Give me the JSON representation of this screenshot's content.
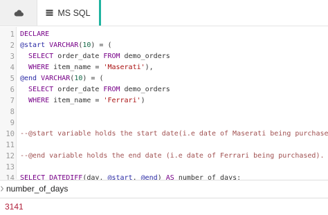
{
  "tabs": {
    "cloud_icon": "cloud-icon",
    "db_icon": "database-icon",
    "active_label": "MS SQL",
    "accent_color": "#1fb3a0"
  },
  "editor": {
    "lines": [
      {
        "num": "1",
        "segments": [
          {
            "t": "DECLARE",
            "c": "kw"
          }
        ]
      },
      {
        "num": "2",
        "segments": [
          {
            "t": "@start",
            "c": "var"
          },
          {
            "t": " "
          },
          {
            "t": "VARCHAR",
            "c": "kw"
          },
          {
            "t": "("
          },
          {
            "t": "10",
            "c": "num"
          },
          {
            "t": ") = ("
          }
        ]
      },
      {
        "num": "3",
        "segments": [
          {
            "t": "  "
          },
          {
            "t": "SELECT",
            "c": "kw"
          },
          {
            "t": " order_date "
          },
          {
            "t": "FROM",
            "c": "kw"
          },
          {
            "t": " demo_orders"
          }
        ]
      },
      {
        "num": "4",
        "segments": [
          {
            "t": "  "
          },
          {
            "t": "WHERE",
            "c": "kw"
          },
          {
            "t": " item_name = "
          },
          {
            "t": "'Maserati'",
            "c": "str"
          },
          {
            "t": "),"
          }
        ]
      },
      {
        "num": "5",
        "segments": [
          {
            "t": "@end",
            "c": "var"
          },
          {
            "t": " "
          },
          {
            "t": "VARCHAR",
            "c": "kw"
          },
          {
            "t": "("
          },
          {
            "t": "10",
            "c": "num"
          },
          {
            "t": ") = ("
          }
        ]
      },
      {
        "num": "6",
        "segments": [
          {
            "t": "  "
          },
          {
            "t": "SELECT",
            "c": "kw"
          },
          {
            "t": " order_date "
          },
          {
            "t": "FROM",
            "c": "kw"
          },
          {
            "t": " demo_orders"
          }
        ]
      },
      {
        "num": "7",
        "segments": [
          {
            "t": "  "
          },
          {
            "t": "WHERE",
            "c": "kw"
          },
          {
            "t": " item_name = "
          },
          {
            "t": "'Ferrari'",
            "c": "str"
          },
          {
            "t": ")"
          }
        ]
      },
      {
        "num": "8",
        "segments": []
      },
      {
        "num": "9",
        "segments": []
      },
      {
        "num": "10",
        "segments": [
          {
            "t": "--@start variable holds the start date(i.e date of Maserati being purchased).",
            "c": "cm"
          }
        ]
      },
      {
        "num": "11",
        "segments": []
      },
      {
        "num": "12",
        "segments": [
          {
            "t": "--@end variable holds the end date (i.e date of Ferrari being purchased).",
            "c": "cm"
          }
        ]
      },
      {
        "num": "13",
        "segments": []
      },
      {
        "num": "14",
        "segments": [
          {
            "t": "SELECT",
            "c": "kw"
          },
          {
            "t": " "
          },
          {
            "t": "DATEDIFF",
            "c": "kw"
          },
          {
            "t": "(day, "
          },
          {
            "t": "@start",
            "c": "var"
          },
          {
            "t": ", "
          },
          {
            "t": "@end",
            "c": "var"
          },
          {
            "t": ") "
          },
          {
            "t": "AS",
            "c": "kw"
          },
          {
            "t": " number_of_days;"
          }
        ]
      }
    ]
  },
  "results": {
    "row_marker_icon": "row-marker-icon",
    "column_header": "number_of_days",
    "value": "3141"
  }
}
